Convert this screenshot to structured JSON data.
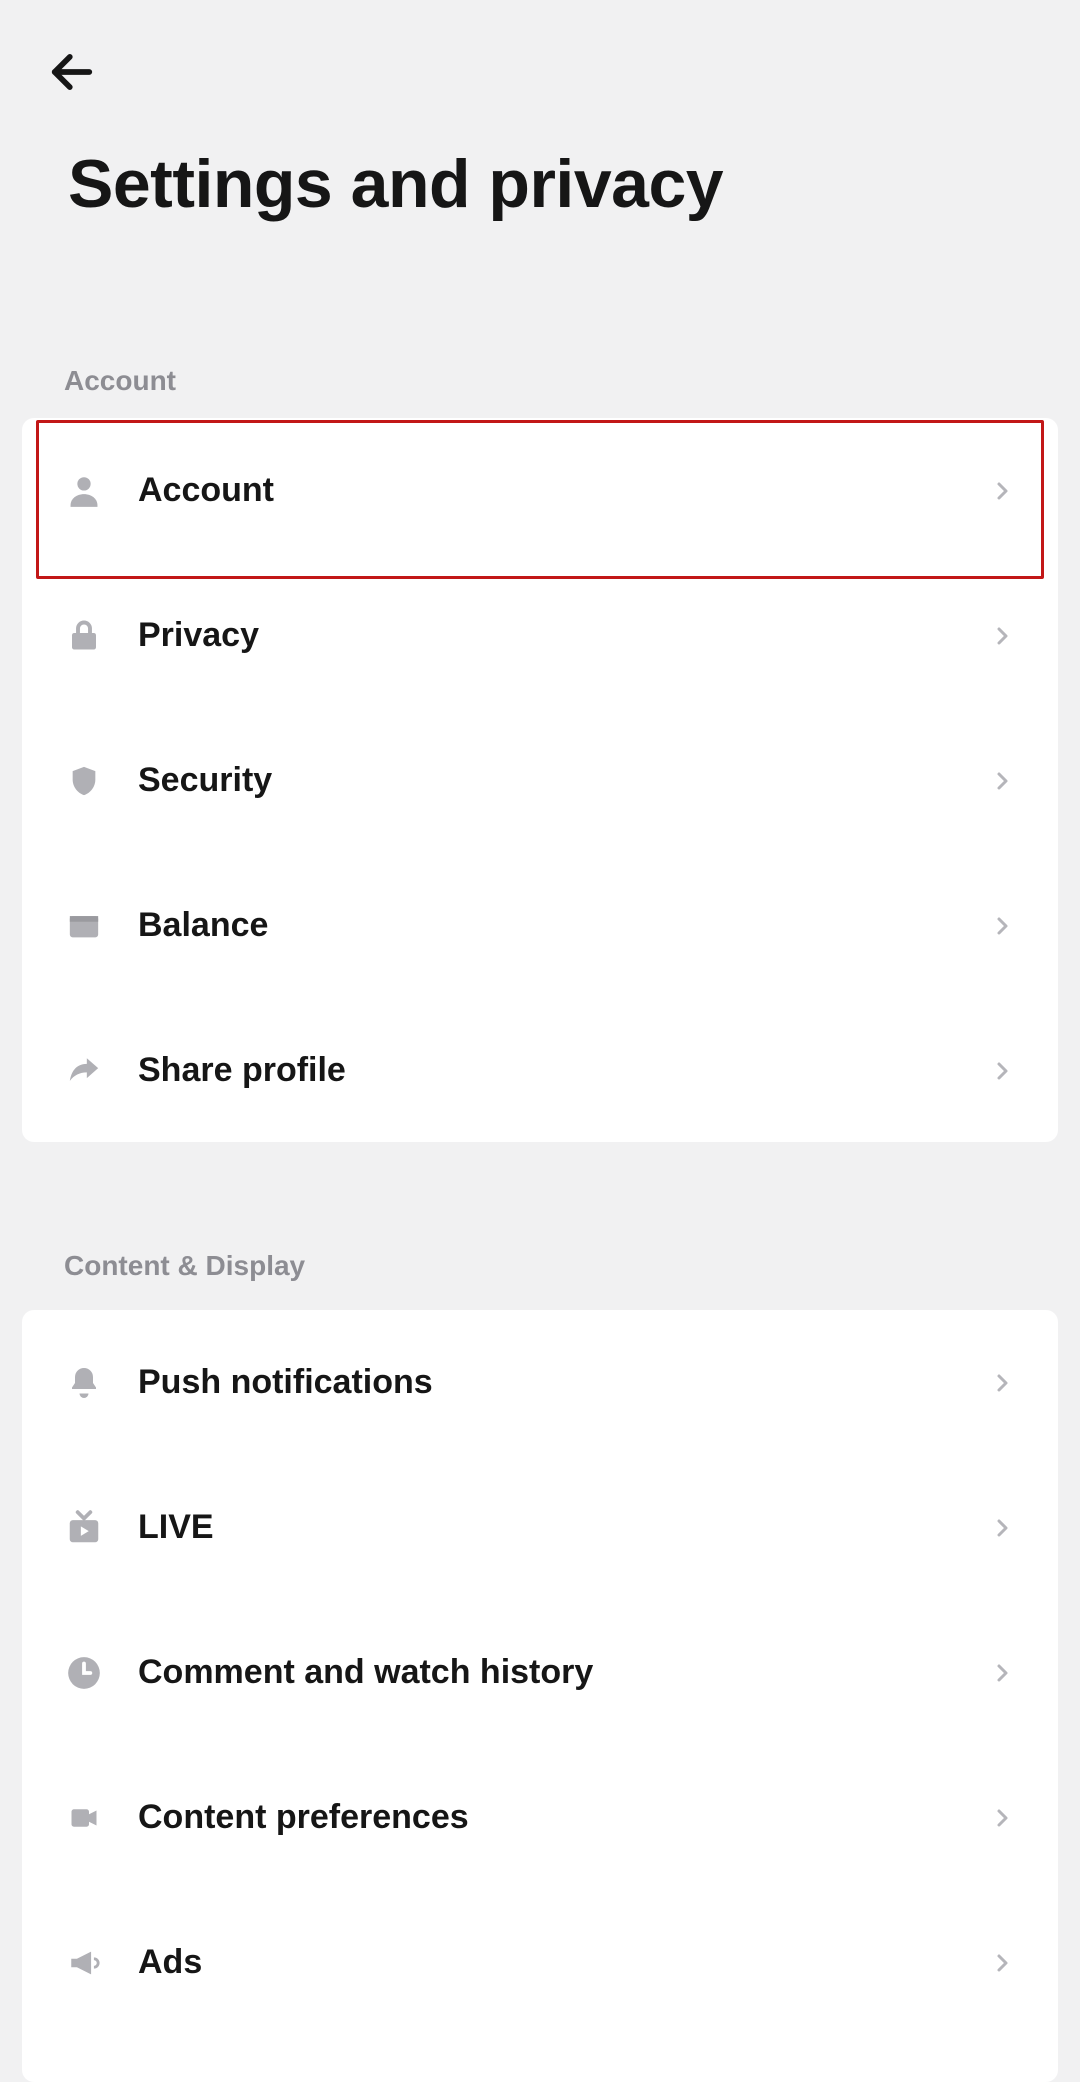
{
  "page_title": "Settings and privacy",
  "sections": [
    {
      "header": "Account",
      "items": [
        {
          "label": "Account",
          "icon": "person-icon",
          "highlighted": true
        },
        {
          "label": "Privacy",
          "icon": "lock-icon"
        },
        {
          "label": "Security",
          "icon": "shield-icon"
        },
        {
          "label": "Balance",
          "icon": "wallet-icon"
        },
        {
          "label": "Share profile",
          "icon": "share-icon"
        }
      ]
    },
    {
      "header": "Content & Display",
      "items": [
        {
          "label": "Push notifications",
          "icon": "bell-icon"
        },
        {
          "label": "LIVE",
          "icon": "tv-icon"
        },
        {
          "label": "Comment and watch history",
          "icon": "clock-icon"
        },
        {
          "label": "Content preferences",
          "icon": "video-icon"
        },
        {
          "label": "Ads",
          "icon": "megaphone-icon"
        }
      ]
    }
  ]
}
